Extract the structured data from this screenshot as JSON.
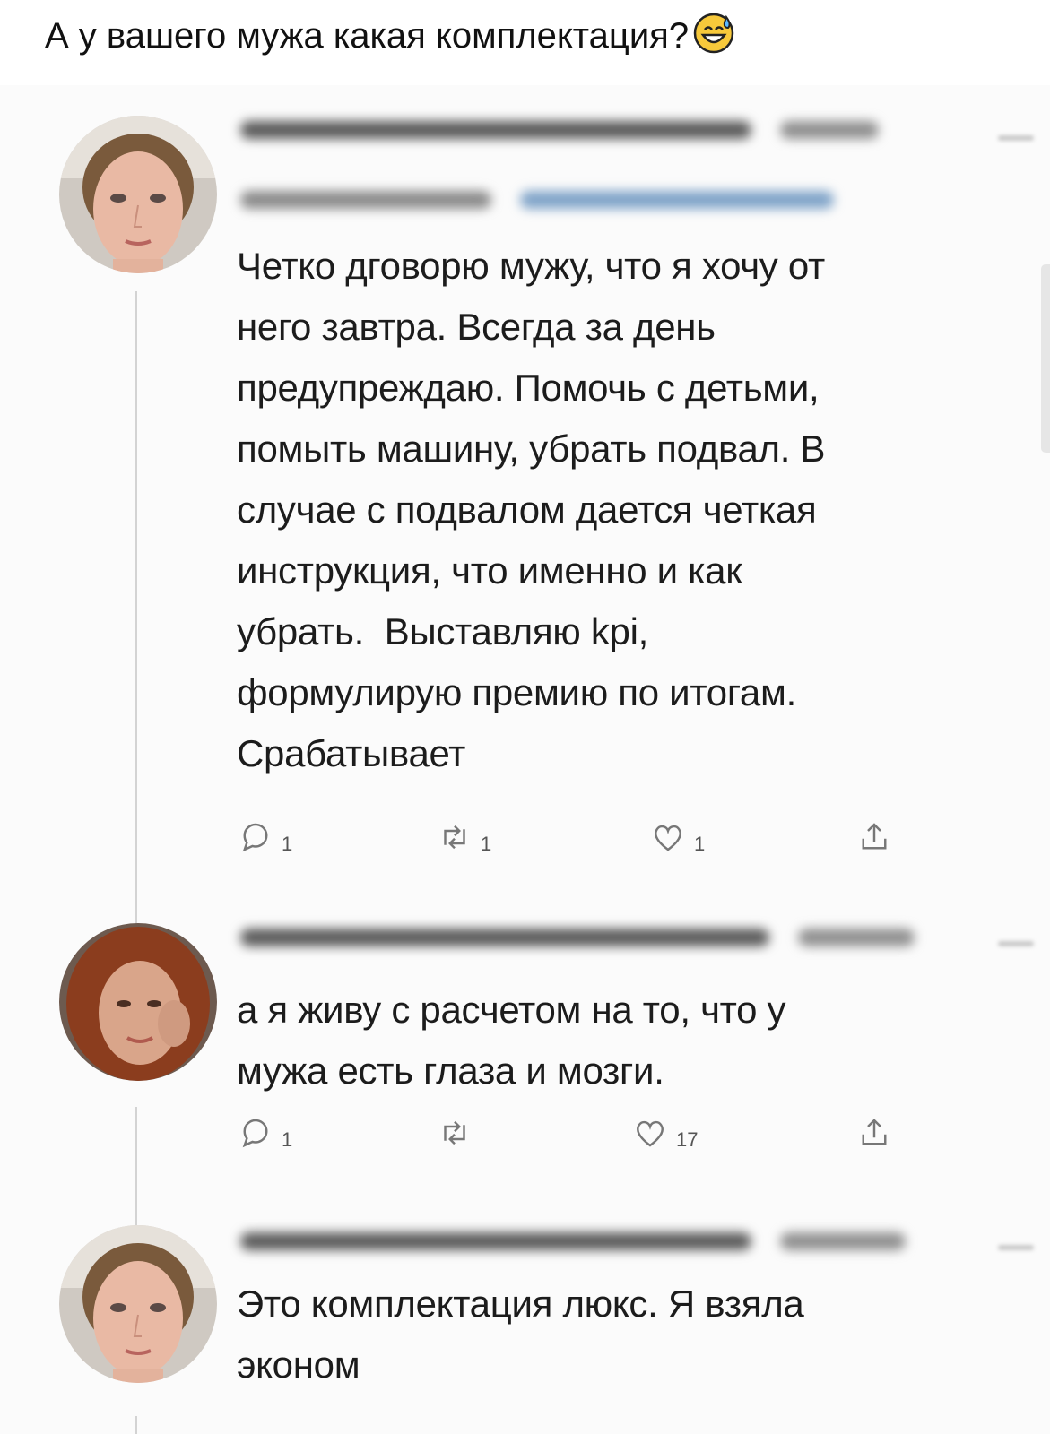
{
  "caption": {
    "text": "А у вашего мужа какая комплектация?",
    "emoji": "grinning-face-with-sweat-icon"
  },
  "tweets": [
    {
      "author_blurred": true,
      "avatar": "woman-short-hair-avatar",
      "text": "Четко дговорю мужу, что я хочу от\nнего завтра. Всегда за день\nпредупреждаю. Помочь с детьми,\nпомыть машину, убрать подвал. В\nслучае с подвалом дается четкая\nинструкция, что именно и как\nубрать.  Выставляю kpi,\nформулирую премию по итогам.\nСрабатывает",
      "reply_count": "1",
      "retweet_count": "1",
      "like_count": "1"
    },
    {
      "author_blurred": true,
      "avatar": "woman-red-hair-avatar",
      "text": "а я живу с расчетом на то, что у\nмужа есть глаза и мозги.",
      "reply_count": "1",
      "retweet_count": "",
      "like_count": "17"
    },
    {
      "author_blurred": true,
      "avatar": "woman-short-hair-avatar",
      "text": "Это комплектация люкс. Я взяла\nэконом"
    }
  ],
  "colors": {
    "text": "#1c1c1c",
    "icon": "#666666",
    "thread_line": "#d3d3d3",
    "blur_name": "#5a5a5a",
    "blur_handle": "#7fa3c8"
  }
}
